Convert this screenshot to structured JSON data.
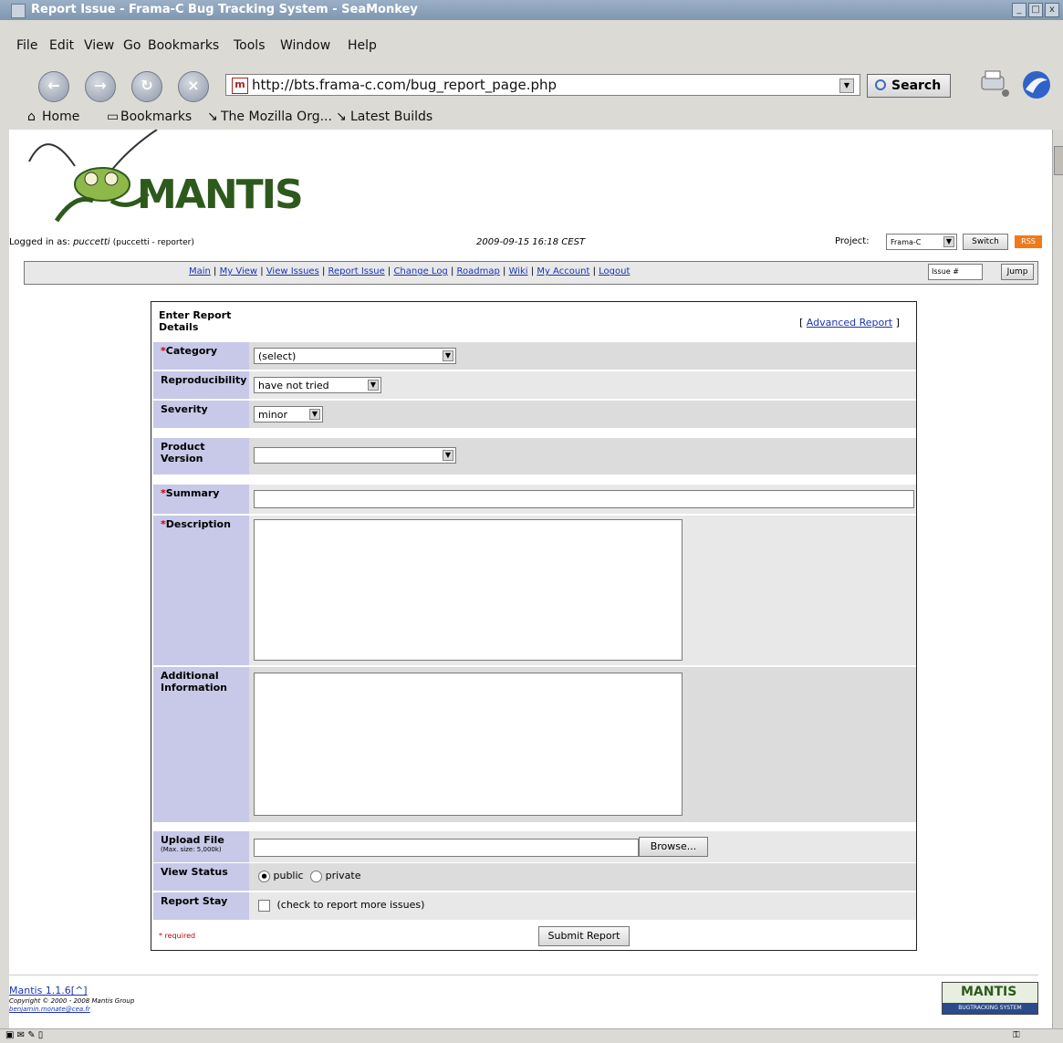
{
  "window": {
    "title": "Report Issue - Frama-C Bug Tracking System - SeaMonkey"
  },
  "menubar": {
    "items": [
      "File",
      "Edit",
      "View",
      "Go",
      "Bookmarks",
      "Tools",
      "Window",
      "Help"
    ]
  },
  "navbar": {
    "url": "http://bts.frama-c.com/bug_report_page.php",
    "search_label": "Search"
  },
  "personal_toolbar": {
    "items": [
      "Home",
      "Bookmarks",
      "The Mozilla Org...",
      "Latest Builds"
    ]
  },
  "page": {
    "logo_text": "MANTIS",
    "logged_in_label": "Logged in as:",
    "username": "puccetti",
    "user_role": "(puccetti - reporter)",
    "datetime": "2009-09-15 16:18 CEST",
    "project_label": "Project:",
    "project_value": "Frama-C",
    "switch_label": "Switch",
    "rss_label": "RSS",
    "issue_placeholder": "Issue #",
    "jump_label": "Jump",
    "nav_links": [
      "Main",
      "My View",
      "View Issues",
      "Report Issue",
      "Change Log",
      "Roadmap",
      "Wiki",
      "My Account",
      "Logout"
    ]
  },
  "form": {
    "header": "Enter Report Details",
    "advanced_link": "Advanced Report",
    "category_label": "Category",
    "category_value": "(select)",
    "reproducibility_label": "Reproducibility",
    "reproducibility_value": "have not tried",
    "severity_label": "Severity",
    "severity_value": "minor",
    "product_version_label": "Product Version",
    "product_version_value": "",
    "summary_label": "Summary",
    "description_label": "Description",
    "additional_label": "Additional Information",
    "upload_label": "Upload File",
    "upload_hint": "(Max. size: 5,000k)",
    "browse_label": "Browse...",
    "view_status_label": "View Status",
    "public_label": "public",
    "private_label": "private",
    "report_stay_label": "Report Stay",
    "report_stay_hint": "(check to report more issues)",
    "required_note": "* required",
    "submit_label": "Submit Report"
  },
  "footer": {
    "version_link": "Mantis 1.1.6",
    "top_link": "[^]",
    "copyright": "Copyright © 2000 - 2008 Mantis Group",
    "email": "benjamin.monate@cea.fr",
    "badge_title": "MANTIS",
    "badge_sub": "BUGTRACKING SYSTEM"
  },
  "colors": {
    "label_bg": "#c8c8e8",
    "row_bg": "#dcdcdc",
    "link": "#1b34b0",
    "required": "#cc0000"
  }
}
